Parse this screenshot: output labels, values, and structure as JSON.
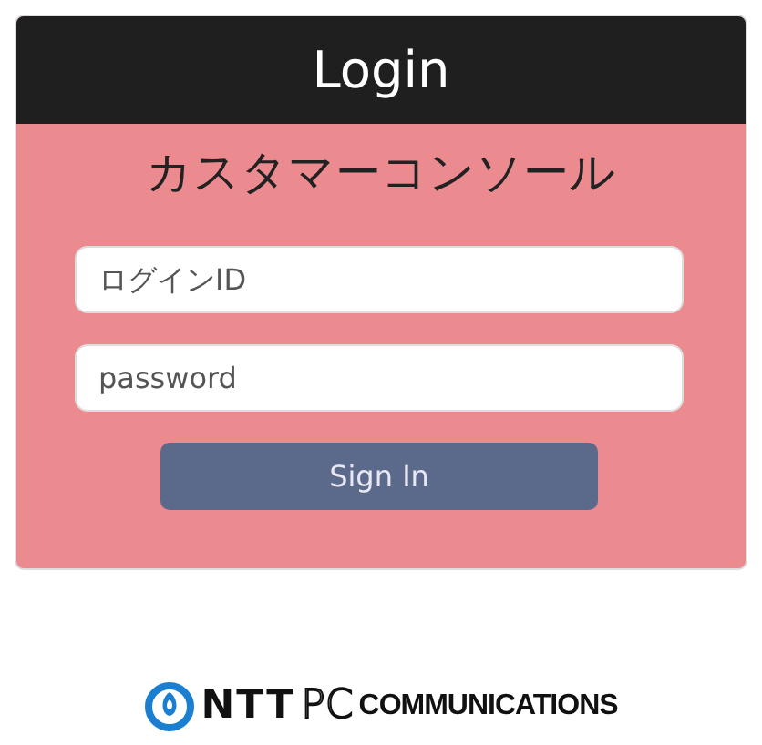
{
  "card": {
    "title": "Login",
    "heading": "カスタマーコンソール",
    "fields": [
      {
        "placeholder": "ログインID"
      },
      {
        "placeholder": "password"
      }
    ],
    "button": "Sign In"
  },
  "logo": {
    "parts": [
      "NTT",
      "PC",
      "COMMUNICATIONS"
    ]
  }
}
